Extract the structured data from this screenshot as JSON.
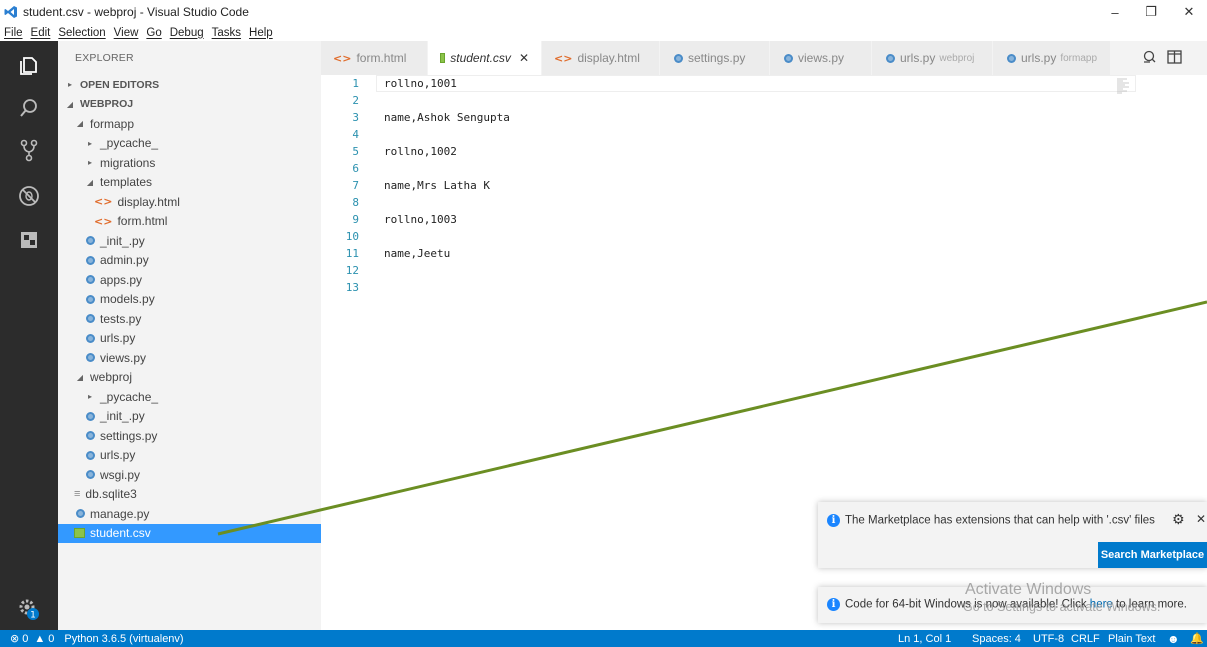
{
  "window": {
    "title": "student.csv - webproj - Visual Studio Code",
    "minimize": "–",
    "maximize": "❐",
    "close": "✕"
  },
  "menu": [
    "File",
    "Edit",
    "Selection",
    "View",
    "Go",
    "Debug",
    "Tasks",
    "Help"
  ],
  "activity": {
    "icons": [
      "files-icon",
      "search-icon",
      "source-control-icon",
      "debug-icon",
      "extensions-icon"
    ],
    "settings_badge": "1"
  },
  "sidebar": {
    "header": "EXPLORER",
    "tree": [
      {
        "label": "OPEN EDITORS",
        "type": "section",
        "indent": 0,
        "twisty": "▸"
      },
      {
        "label": "WEBPROJ",
        "type": "section",
        "indent": 0,
        "twisty": "◢"
      },
      {
        "label": "formapp",
        "type": "folder",
        "indent": 1,
        "twisty": "◢"
      },
      {
        "label": "_pycache_",
        "type": "folder",
        "indent": 2,
        "twisty": "▸"
      },
      {
        "label": "migrations",
        "type": "folder",
        "indent": 2,
        "twisty": "▸"
      },
      {
        "label": "templates",
        "type": "folder",
        "indent": 2,
        "twisty": "◢"
      },
      {
        "label": "display.html",
        "type": "html",
        "indent": 3
      },
      {
        "label": "form.html",
        "type": "html",
        "indent": 3
      },
      {
        "label": "_init_.py",
        "type": "py",
        "indent": 2
      },
      {
        "label": "admin.py",
        "type": "py",
        "indent": 2
      },
      {
        "label": "apps.py",
        "type": "py",
        "indent": 2
      },
      {
        "label": "models.py",
        "type": "py",
        "indent": 2
      },
      {
        "label": "tests.py",
        "type": "py",
        "indent": 2
      },
      {
        "label": "urls.py",
        "type": "py",
        "indent": 2
      },
      {
        "label": "views.py",
        "type": "py",
        "indent": 2
      },
      {
        "label": "webproj",
        "type": "folder",
        "indent": 1,
        "twisty": "◢"
      },
      {
        "label": "_pycache_",
        "type": "folder",
        "indent": 2,
        "twisty": "▸"
      },
      {
        "label": "_init_.py",
        "type": "py",
        "indent": 2
      },
      {
        "label": "settings.py",
        "type": "py",
        "indent": 2
      },
      {
        "label": "urls.py",
        "type": "py",
        "indent": 2
      },
      {
        "label": "wsgi.py",
        "type": "py",
        "indent": 2
      },
      {
        "label": "db.sqlite3",
        "type": "db",
        "indent": 1
      },
      {
        "label": "manage.py",
        "type": "py",
        "indent": 1
      },
      {
        "label": "student.csv",
        "type": "csv",
        "indent": 1,
        "selected": true
      }
    ]
  },
  "tabs": [
    {
      "label": "form.html",
      "type": "html"
    },
    {
      "label": "student.csv",
      "type": "csv",
      "active": true,
      "close": "✕"
    },
    {
      "label": "display.html",
      "type": "html"
    },
    {
      "label": "settings.py",
      "type": "py"
    },
    {
      "label": "views.py",
      "type": "py"
    },
    {
      "label": "urls.py",
      "type": "py",
      "sub": "webproj"
    },
    {
      "label": "urls.py",
      "type": "py",
      "sub": "formapp"
    }
  ],
  "editor": {
    "lines": [
      "rollno,1001",
      "",
      "name,Ashok Sengupta",
      "",
      "rollno,1002",
      "",
      "name,Mrs Latha K",
      "",
      "rollno,1003",
      "",
      "name,Jeetu",
      "",
      ""
    ]
  },
  "notifications": {
    "marketplace": {
      "text": "The Marketplace has extensions that can help with '.csv' files",
      "button": "Search Marketplace"
    },
    "update": {
      "text_before": "Code for 64-bit Windows is now available! Click ",
      "link": "here",
      "text_after": " to learn more."
    }
  },
  "watermark": {
    "line1": "Activate Windows",
    "line2": "Go to Settings to activate Windows."
  },
  "status": {
    "errors": "0",
    "warnings": "0",
    "python": "Python 3.6.5 (virtualenv)",
    "position": "Ln 1, Col 1",
    "spaces": "Spaces: 4",
    "encoding": "UTF-8",
    "eol": "CRLF",
    "language": "Plain Text"
  },
  "colors": {
    "statusbar": "#007acc",
    "selection": "#3399ff",
    "annotation_arrow": "#6b8e23"
  }
}
